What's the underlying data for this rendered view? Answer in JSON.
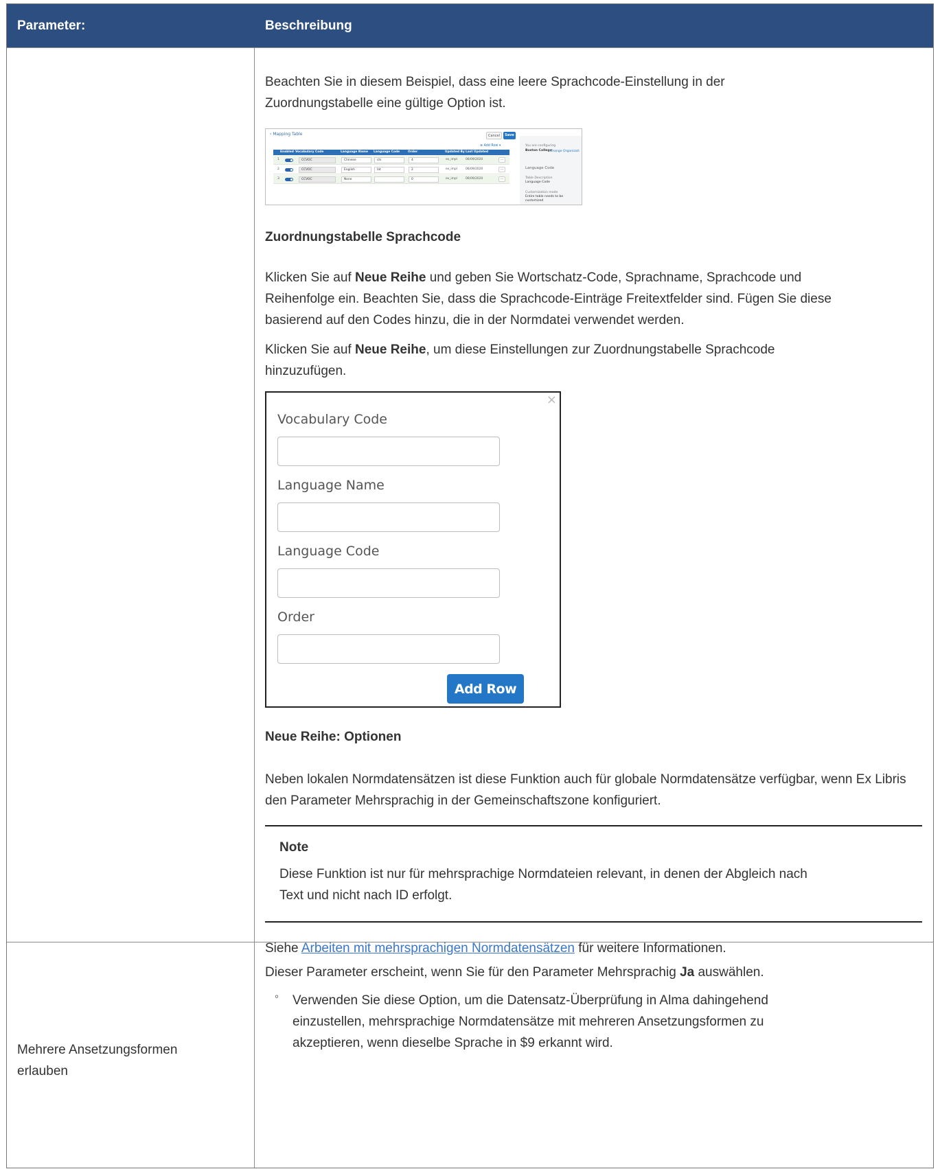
{
  "table": {
    "header": {
      "param": "Parameter:",
      "desc": "Beschreibung"
    }
  },
  "row1": {
    "intro": "Beachten Sie in diesem Beispiel, dass eine leere Sprachcode-Einstellung in der Zuordnungstabelle eine gültige Option ist.",
    "mapping_screenshot": {
      "title": "Mapping Table",
      "cancel": "Cancel",
      "save": "Save",
      "add_row": "Add Row",
      "columns": [
        "Enabled",
        "Vocabulary Code",
        "Language Name",
        "Language Code",
        "Order",
        "Updated By",
        "Last Updated"
      ],
      "rows": [
        {
          "n": "1",
          "vocab": "CCVOC",
          "name": "Chinese",
          "code": "chi",
          "order": "4",
          "by": "ex_impl",
          "date": "06/09/2020"
        },
        {
          "n": "2",
          "vocab": "CCVOC",
          "name": "English",
          "code": "lat",
          "order": "2",
          "by": "ex_impl",
          "date": "06/09/2020"
        },
        {
          "n": "3",
          "vocab": "CCVOC",
          "name": "None",
          "code": "",
          "order": "0",
          "by": "ex_impl",
          "date": "06/09/2020"
        }
      ],
      "side": {
        "configuring": "You are configuring",
        "institution": "Boston College",
        "change": "Change Organizati",
        "section": "Language Code",
        "desc_label": "Table Description",
        "desc_value": "Language Code",
        "cust_label": "Customization mode",
        "cust_value_1": "Entire table needs to be",
        "cust_value_2": "customized"
      }
    },
    "caption1": "Zuordnungstabelle Sprachcode",
    "p1_a": "Klicken Sie auf ",
    "p1_b": "Neue Reihe",
    "p1_c": " und geben Sie Wortschatz-Code, Sprachname, Sprachcode und Reihenfolge ein. Beachten Sie, dass die Sprachcode-Einträge Freitextfelder sind. Fügen Sie diese basierend auf den Codes hinzu, die in der Normdatei verwendet werden.",
    "p2_a": "Klicken Sie auf ",
    "p2_b": "Neue Reihe",
    "p2_c": ", um diese Einstellungen zur Zuordnungstabelle Sprachcode hinzuzufügen.",
    "dialog": {
      "close": "×",
      "vocab_label": "Vocabulary Code",
      "name_label": "Language Name",
      "code_label": "Language Code",
      "order_label": "Order",
      "button": "Add Row"
    },
    "caption2": "Neue Reihe: Optionen",
    "p3": "Neben lokalen Normdatensätzen ist diese Funktion auch für globale Normdatensätze verfügbar, wenn Ex Libris den Parameter Mehrsprachig in der Gemeinschaftszone konfiguriert.",
    "note": {
      "title": "Note",
      "text": "Diese Funktion ist nur für mehrsprachige Normdateien relevant, in denen der Abgleich nach Text und nicht nach ID erfolgt."
    },
    "see_a": "Siehe ",
    "see_link": "Arbeiten mit mehrsprachigen Normdatensätzen",
    "see_b": " für weitere Informationen."
  },
  "row2": {
    "param": "Mehrere Ansetzungsformen erlauben",
    "p_a": "Dieser Parameter erscheint, wenn Sie für den Parameter Mehrsprachig ",
    "p_b": "Ja",
    "p_c": " auswählen.",
    "bullet_symbol": "◦",
    "bullet": "Verwenden Sie diese Option, um die Datensatz-Überprüfung in Alma dahingehend einzustellen, mehrsprachige Normdatensätze mit mehreren Ansetzungsformen zu akzeptieren, wenn dieselbe Sprache in $9 erkannt wird."
  }
}
